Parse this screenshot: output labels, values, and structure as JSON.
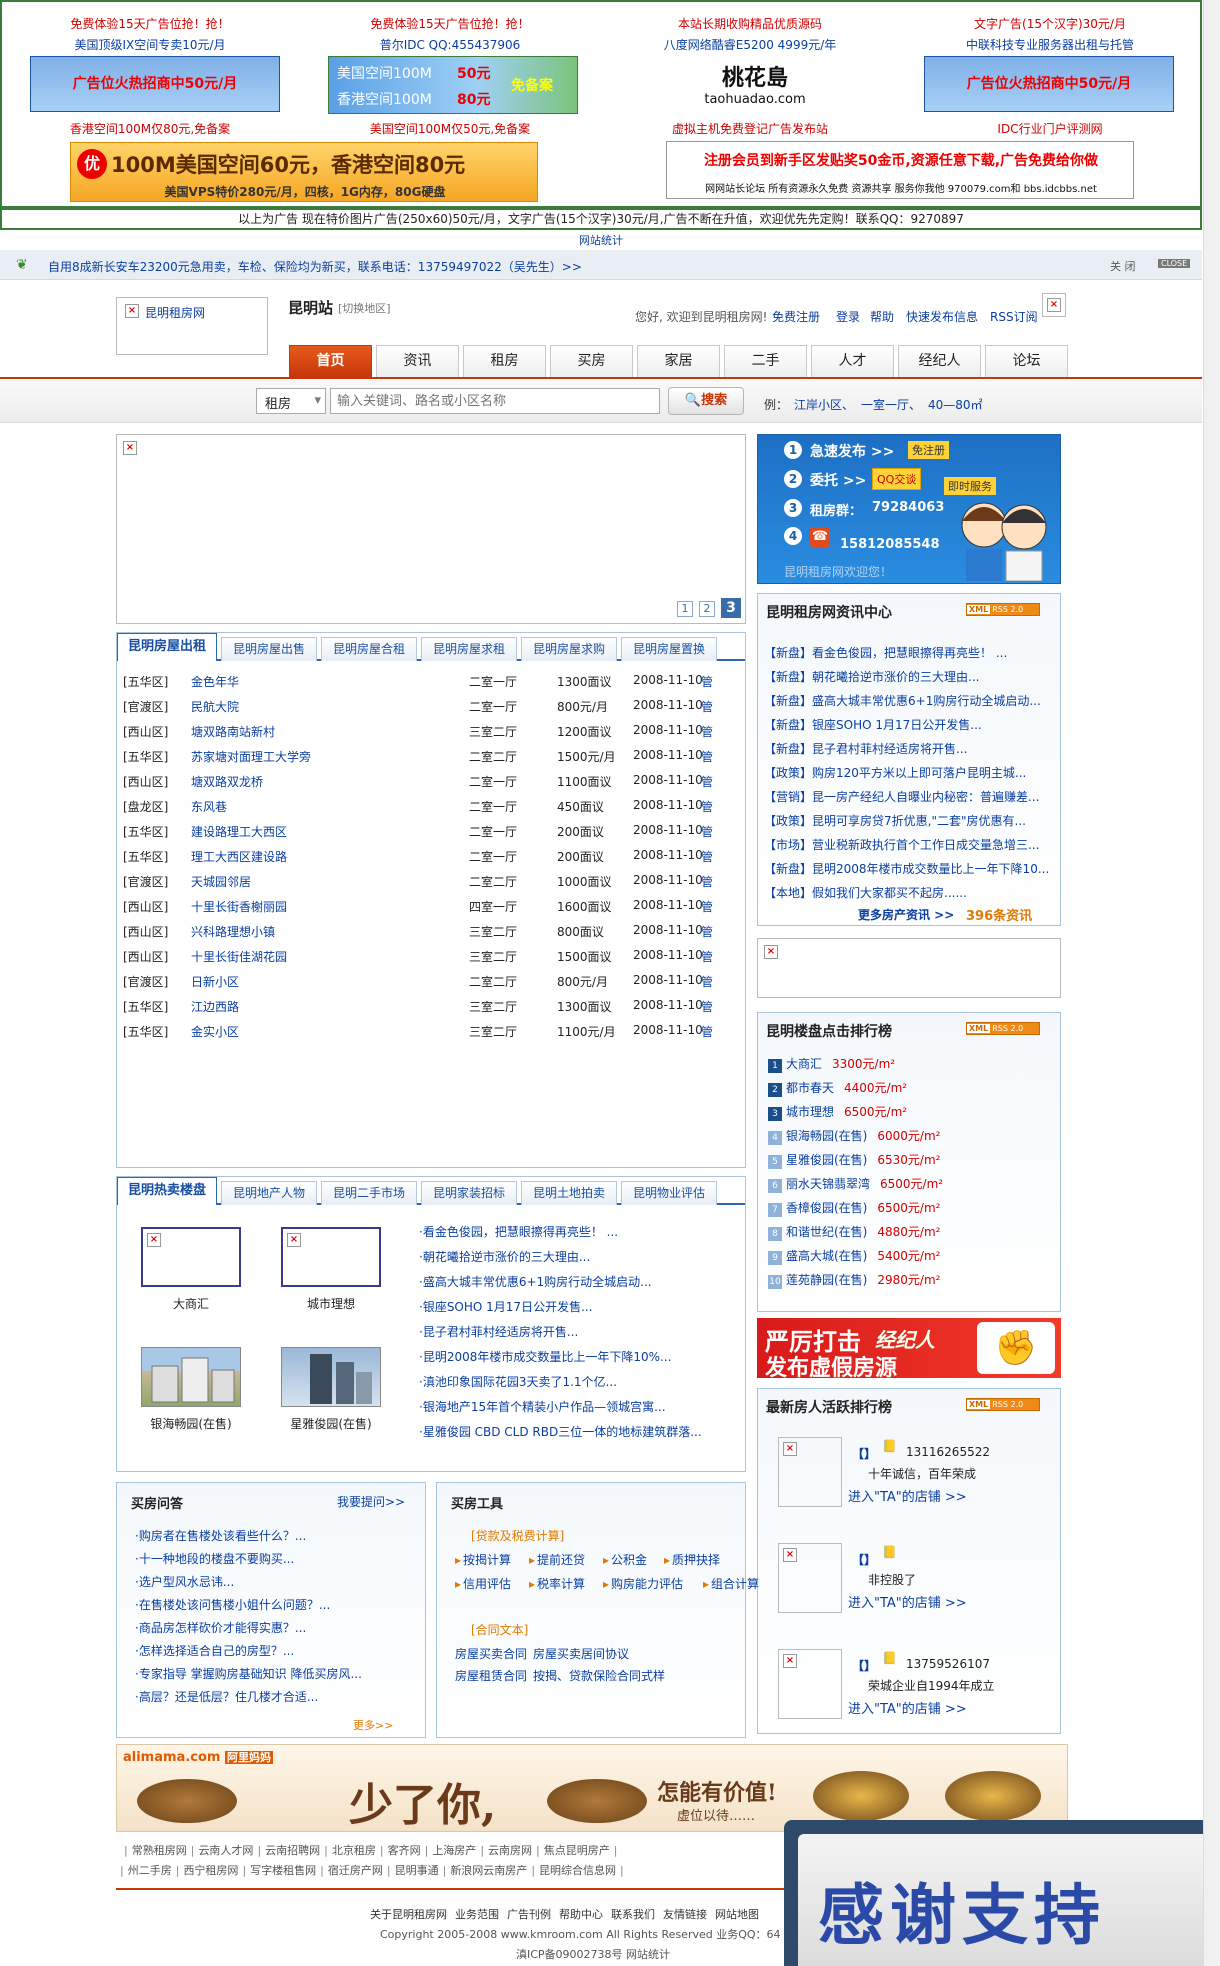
{
  "top_ads": {
    "col1": {
      "line1": "免费体验15天广告位抢！抢！",
      "line2": "美国顶级IX空间专卖10元/月",
      "banner": "广告位火热招商中50元/月",
      "line3": "香港空间100M仅80元,免备案"
    },
    "col2": {
      "line1": "免费体验15天广告位抢！抢！",
      "line2": "普尔IDC QQ:455437906",
      "banner_l1": "美国空间100M",
      "banner_p1": "50元",
      "banner_l2": "香港空间100M",
      "banner_p2": "80元",
      "banner_tag": "免备案",
      "line3": "美国空间100M仅50元,免备案"
    },
    "col3": {
      "line1": "本站长期收购精品优质源码",
      "line2": "八度网络酷睿E5200 4999元/年",
      "logo_cn": "桃花島",
      "logo_en": "taohuadao.com",
      "line3": "虚拟主机免费登记广告发布站"
    },
    "col4": {
      "line1": "文字广告(15个汉字)30元/月",
      "line2": "中联科技专业服务器出租与托管",
      "banner": "广告位火热招商中50元/月",
      "line3": "IDC行业门户评测网"
    },
    "wide_ad": {
      "icon": "优",
      "main": "100M美国空间60元，香港空间80元",
      "sub": "美国VPS特价280元/月，四核，1G内存，80G硬盘"
    },
    "reg_ad": {
      "main": "注册会员到新手区发贴奖50金币,资源任意下载,广告免费给你做",
      "sub": "网网站长论坛  所有资源永久免费  资源共享  服务你我他  970079.com和 bbs.idcbbs.net"
    },
    "notice": "以上为广告  现在特价图片广告(250x60)50元/月，文字广告(15个汉字)30元/月,广告不断在升值，欢迎优先先定购！联系QQ：9270897",
    "stats": "网站统计"
  },
  "notice_bar": {
    "text": "自用8成新长安车23200元急用卖，车检、保险均为新买，联系电话：13759497022（吴先生）>>",
    "close": "关 闭",
    "close_btn": "CLOSE"
  },
  "header": {
    "logo_alt": "昆明租房网",
    "city": "昆明站",
    "switch": "[切换地区]",
    "welcome": "您好, 欢迎到昆明租房网!",
    "links": [
      "免费注册",
      "登录",
      "帮助",
      "快速发布信息",
      "RSS订阅"
    ]
  },
  "nav": [
    "首页",
    "资讯",
    "租房",
    "买房",
    "家居",
    "二手",
    "人才",
    "经纪人",
    "论坛"
  ],
  "search": {
    "select": "租房",
    "placeholder": "输入关键词、路名或小区名称",
    "button": "搜索",
    "eg_label": "例：",
    "eg": [
      "江岸小区、",
      "一室一厅、",
      "40—80㎡"
    ]
  },
  "slider": {
    "pages": [
      "1",
      "2",
      "3"
    ]
  },
  "rent_tabs": [
    "昆明房屋出租",
    "昆明房屋出售",
    "昆明房屋合租",
    "昆明房屋求租",
    "昆明房屋求购",
    "昆明房屋置换"
  ],
  "rent_rows": [
    [
      "[五华区]",
      "金色年华",
      "二室一厅",
      "1300面议",
      "2008-11-10",
      "管"
    ],
    [
      "[官渡区]",
      "民航大院",
      "二室一厅",
      "800元/月",
      "2008-11-10",
      "管"
    ],
    [
      "[西山区]",
      "塘双路南站新村",
      "三室二厅",
      "1200面议",
      "2008-11-10",
      "管"
    ],
    [
      "[五华区]",
      "苏家塘对面理工大学旁",
      "二室二厅",
      "1500元/月",
      "2008-11-10",
      "管"
    ],
    [
      "[西山区]",
      "塘双路双龙桥",
      "二室一厅",
      "1100面议",
      "2008-11-10",
      "管"
    ],
    [
      "[盘龙区]",
      "东风巷",
      "二室一厅",
      "450面议",
      "2008-11-10",
      "管"
    ],
    [
      "[五华区]",
      "建设路理工大西区",
      "二室一厅",
      "200面议",
      "2008-11-10",
      "管"
    ],
    [
      "[五华区]",
      "理工大西区建设路",
      "二室一厅",
      "200面议",
      "2008-11-10",
      "管"
    ],
    [
      "[官渡区]",
      "天城园邻居",
      "二室二厅",
      "1000面议",
      "2008-11-10",
      "管"
    ],
    [
      "[西山区]",
      "十里长街香榭丽园",
      "四室一厅",
      "1600面议",
      "2008-11-10",
      "管"
    ],
    [
      "[西山区]",
      "兴科路理想小镇",
      "三室二厅",
      "800面议",
      "2008-11-10",
      "管"
    ],
    [
      "[西山区]",
      "十里长街佳湖花园",
      "三室二厅",
      "1500面议",
      "2008-11-10",
      "管"
    ],
    [
      "[官渡区]",
      "日新小区",
      "二室二厅",
      "800元/月",
      "2008-11-10",
      "管"
    ],
    [
      "[五华区]",
      "江边西路",
      "三室二厅",
      "1300面议",
      "2008-11-10",
      "管"
    ],
    [
      "[五华区]",
      "金实小区",
      "三室二厅",
      "1100元/月",
      "2008-11-10",
      "管"
    ]
  ],
  "hot_tabs": [
    "昆明热卖楼盘",
    "昆明地产人物",
    "昆明二手市场",
    "昆明家装招标",
    "昆明土地拍卖",
    "昆明物业评估"
  ],
  "hot_props": [
    "大商汇",
    "城市理想",
    "银海畅园(在售)",
    "星雅俊园(在售)"
  ],
  "hot_news": [
    "·看金色俊园，把慧眼擦得再亮些！ ...",
    "·朝花曦拾逆市涨价的三大理由...",
    "·盛高大城丰常优惠6+1购房行动全城启动...",
    "·银座SOHO 1月17日公开发售...",
    "·昆子君村菲村经适房将开售...",
    "·昆明2008年楼市成交数量比上一年下降10%...",
    "·滇池印象国际花园3天卖了1.1个亿...",
    "·银海地产15年首个精装小户作品—领城宫寓...",
    "·星雅俊园 CBD CLD RBD三位一体的地标建筑群落..."
  ],
  "qa": {
    "title": "买房问答",
    "ask": "我要提问>>",
    "items": [
      "·购房者在售楼处该看些什么？...",
      "·十一种地段的楼盘不要购买...",
      "·选户型风水忌讳...",
      "·在售楼处该问售楼小姐什么问题？...",
      "·商品房怎样砍价才能得实惠？...",
      "·怎样选择适合自己的房型？...",
      "·专家指导 掌握购房基础知识  降低买房风...",
      "·高层？还是低层？住几楼才合适..."
    ],
    "more": "更多>>"
  },
  "tools": {
    "title": "买房工具",
    "sec1": "[贷款及税费计算]",
    "items1": [
      "按揭计算",
      "提前还贷",
      "公积金",
      "质押抉择"
    ],
    "items2": [
      "信用评估",
      "税率计算",
      "购房能力评估",
      "组合计算"
    ],
    "sec2": "[合同文本]",
    "c1": [
      "房屋买卖合同",
      "房屋买卖居间协议"
    ],
    "c2": [
      "房屋租赁合同",
      "按揭、贷款保险合同式样"
    ]
  },
  "service": {
    "items": [
      "急速发布 >>",
      "委托 >>",
      "租房群：",
      "4"
    ],
    "publish": "免注册",
    "qq": "QQ交谈",
    "immediate": "即时服务",
    "group": "79284063",
    "phone": "15812085548",
    "bottom": "昆明租房网欢迎您！"
  },
  "news": {
    "title": "昆明租房网资讯中心",
    "rss_xml": "XML",
    "rss_label": "RSS 2.0",
    "items": [
      [
        "【新盘】",
        "看金色俊园，把慧眼擦得再亮些！ ..."
      ],
      [
        "【新盘】",
        "朝花曦拾逆市涨价的三大理由..."
      ],
      [
        "【新盘】",
        "盛高大城丰常优惠6+1购房行动全城启动..."
      ],
      [
        "【新盘】",
        "银座SOHO 1月17日公开发售..."
      ],
      [
        "【新盘】",
        "昆子君村菲村经适房将开售..."
      ],
      [
        "【政策】",
        "购房120平方米以上即可落户昆明主城..."
      ],
      [
        "【营销】",
        "昆一房产经纪人自曝业内秘密：普遍赚差..."
      ],
      [
        "【政策】",
        "昆明可享房贷7折优惠,\"二套\"房优惠有..."
      ],
      [
        "【市场】",
        "营业税新政执行首个工作日成交量急增三..."
      ],
      [
        "【新盘】",
        "昆明2008年楼市成交数量比上一年下降10..."
      ],
      [
        "【本地】",
        "假如我们大家都买不起房......"
      ]
    ],
    "more": "更多房产资讯 >>",
    "count": "396条资讯"
  },
  "rank": {
    "title": "昆明楼盘点击排行榜",
    "items": [
      [
        "大商汇",
        "3300元/m²"
      ],
      [
        "都市春天",
        "4400元/m²"
      ],
      [
        "城市理想",
        "6500元/m²"
      ],
      [
        "银海畅园(在售)",
        "6000元/m²"
      ],
      [
        "星雅俊园(在售)",
        "6530元/m²"
      ],
      [
        "丽水天锦翡翠湾",
        "6500元/m²"
      ],
      [
        "香樟俊园(在售)",
        "6500元/m²"
      ],
      [
        "和谐世纪(在售)",
        "4880元/m²"
      ],
      [
        "盛高大城(在售)",
        "5400元/m²"
      ],
      [
        "莲苑静园(在售)",
        "2980元/m²"
      ]
    ]
  },
  "warn_ad": {
    "l1": "严厉打击",
    "l1b": "经纪人",
    "l2": "发布虚假房源"
  },
  "agents": {
    "title": "最新房人活跃排行榜",
    "items": [
      {
        "phone": "13116265522",
        "desc": "十年诚信，百年荣成",
        "link": "进入\"TA\"的店铺 >>"
      },
      {
        "phone": "",
        "desc": "非控股了",
        "link": "进入\"TA\"的店铺 >>"
      },
      {
        "phone": "13759526107",
        "desc": "荣城企业自1994年成立",
        "link": "进入\"TA\"的店铺 >>"
      }
    ]
  },
  "alimama": {
    "brand": "alimama.com",
    "brand_cn": "阿里妈妈",
    "slogan1": "少了你,",
    "slogan2": "怎能有价值!",
    "slogan3": "虚位以待……"
  },
  "friend_links_1": [
    "常熟租房网",
    "云南人才网",
    "云南招聘网",
    "北京租房",
    "客齐网",
    "上海房产",
    "云南房网",
    "焦点昆明房产"
  ],
  "friend_links_2": [
    "州二手房",
    "西宁租房网",
    "写字楼租售网",
    "宿迁房产网",
    "昆明事通",
    "新浪网云南房产",
    "昆明综合信息网"
  ],
  "footer": {
    "links": [
      "关于昆明租房网",
      "业务范围",
      "广告刊例",
      "帮助中心",
      "联系我们",
      "友情链接",
      "网站地图"
    ],
    "copy": "Copyright 2005-2008 www.kmroom.com All Rights Reserved 业务QQ：64",
    "icp": "滇ICP备09002738号  网站统计"
  },
  "thanks": "感谢支持"
}
